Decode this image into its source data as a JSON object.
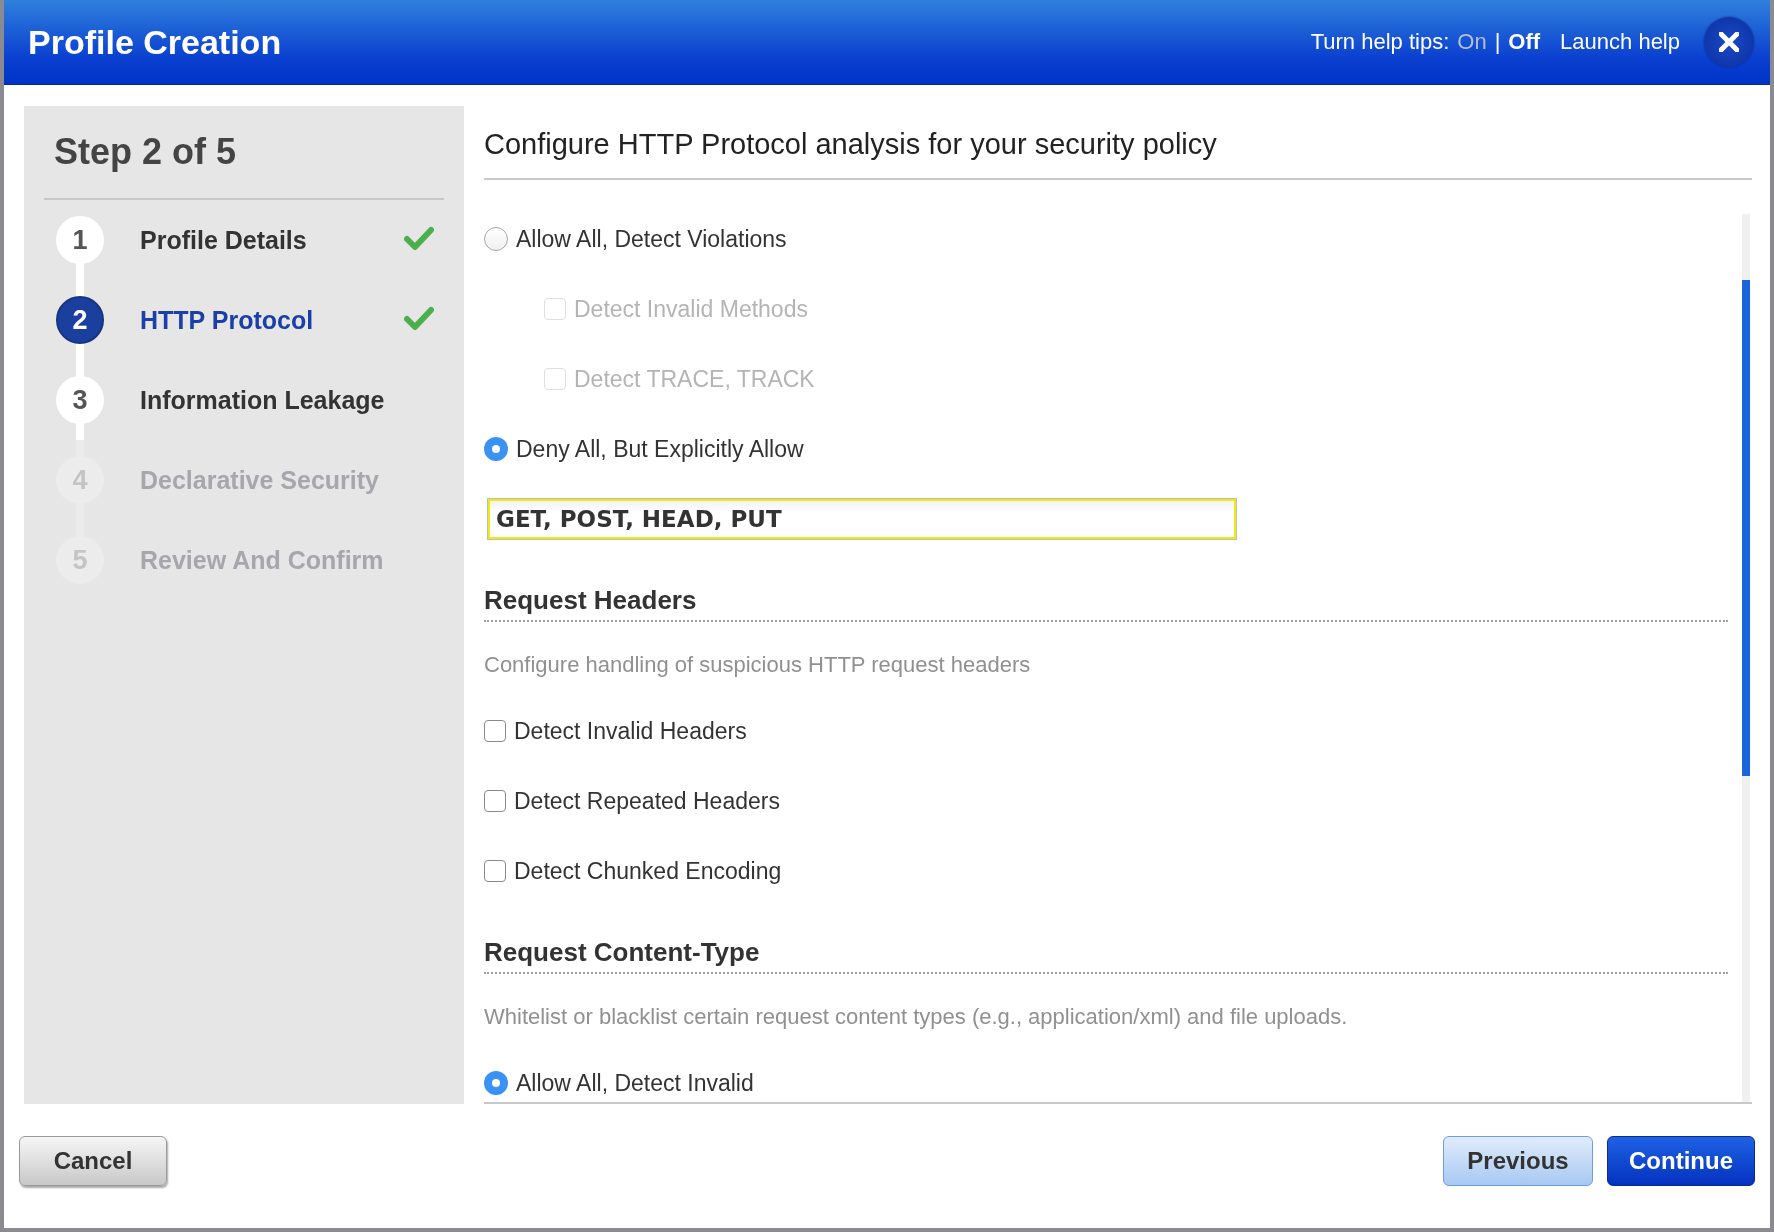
{
  "window": {
    "title": "Profile Creation",
    "help_tips": {
      "label": "Turn help tips:",
      "separator": "|",
      "options": [
        {
          "label": "On",
          "selected": false
        },
        {
          "label": "Off",
          "selected": true
        }
      ]
    },
    "launch_help": "Launch help"
  },
  "sidebar": {
    "title": "Step 2 of 5",
    "steps": [
      {
        "number": "1",
        "label": "Profile Details",
        "selected": false,
        "completed": true,
        "disabled": false
      },
      {
        "number": "2",
        "label": "HTTP Protocol",
        "selected": true,
        "completed": true,
        "disabled": false
      },
      {
        "number": "3",
        "label": "Information Leakage",
        "selected": false,
        "completed": false,
        "disabled": false
      },
      {
        "number": "4",
        "label": "Declarative Security",
        "selected": false,
        "completed": false,
        "disabled": true
      },
      {
        "number": "5",
        "label": "Review And Confirm",
        "selected": false,
        "completed": false,
        "disabled": true
      }
    ]
  },
  "main": {
    "heading": "Configure HTTP Protocol analysis for your security policy",
    "items": [
      {
        "kind": "radio",
        "label": "Allow All, Detect Violations",
        "selected": false,
        "children": [
          {
            "kind": "checkbox",
            "label": "Detect Invalid Methods",
            "checked": false,
            "disabled": true
          },
          {
            "kind": "checkbox",
            "label": "Detect TRACE, TRACK",
            "checked": false,
            "disabled": true
          }
        ]
      },
      {
        "kind": "radio",
        "label": "Deny All, But Explicitly Allow",
        "selected": true
      },
      {
        "kind": "field",
        "value": "GET, POST, HEAD, PUT"
      },
      {
        "kind": "heading",
        "label": "Request Headers"
      },
      {
        "kind": "description",
        "label": "Configure handling of suspicious HTTP request headers"
      },
      {
        "kind": "checkbox",
        "label": "Detect Invalid Headers",
        "checked": false,
        "disabled": false
      },
      {
        "kind": "checkbox",
        "label": "Detect Repeated Headers",
        "checked": false,
        "disabled": false
      },
      {
        "kind": "checkbox",
        "label": "Detect Chunked Encoding",
        "checked": false,
        "disabled": false
      },
      {
        "kind": "heading",
        "label": "Request Content-Type"
      },
      {
        "kind": "description",
        "label": "Whitelist or blacklist certain request content types (e.g., application/xml) and file uploads."
      },
      {
        "kind": "radio",
        "label": "Allow All, Detect Invalid",
        "selected": true
      }
    ]
  },
  "footer": {
    "buttons": [
      {
        "label": "Cancel",
        "kind": "cancel"
      },
      {
        "label": "Previous",
        "kind": "secondary"
      },
      {
        "label": "Continue",
        "kind": "primary"
      }
    ]
  }
}
